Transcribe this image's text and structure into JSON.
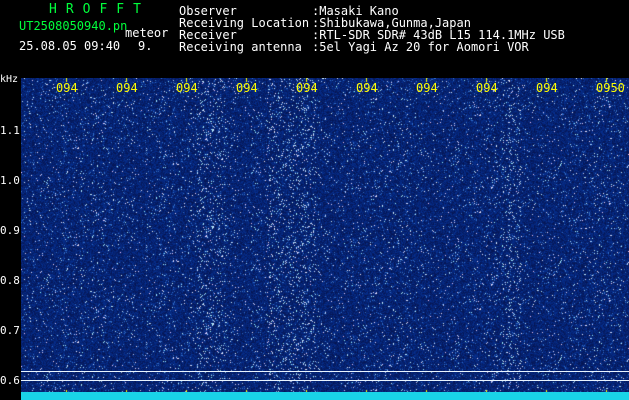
{
  "app": {
    "name": "HROFFT"
  },
  "file": {
    "name": "UT2508050940.pn",
    "type_label": "meteor"
  },
  "session": {
    "datetime": "25.08.05 09:40",
    "count": "9."
  },
  "info": {
    "observer_label": "Observer",
    "observer_value": ":Masaki Kano",
    "location_label": "Receiving Location",
    "location_value": ":Shibukawa,Gunma,Japan",
    "receiver_label": "Receiver",
    "receiver_value": ":RTL-SDR SDR# 43dB L15 114.1MHz USB",
    "antenna_label": "Receiving antenna",
    "antenna_value": ":5el Yagi Az 20 for Aomori VOR"
  },
  "axis": {
    "unit": "kHz",
    "y_ticks": [
      "1.1",
      "1.0",
      "0.9",
      "0.8",
      "0.7",
      "0.6"
    ],
    "x_ticks": [
      "094",
      "094",
      "094",
      "094",
      "094",
      "094",
      "094",
      "094",
      "094",
      "0950"
    ]
  },
  "colors": {
    "header_text": "#00ff3c",
    "background": "#05105e",
    "tick_text": "#ffff00",
    "baseband": "#19d3e8"
  }
}
